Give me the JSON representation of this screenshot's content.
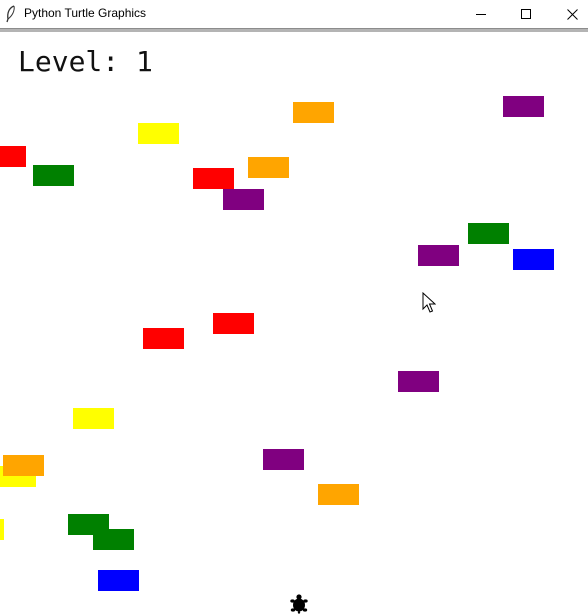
{
  "window": {
    "title": "Python Turtle Graphics",
    "icons": {
      "app": "feather-icon",
      "minimize": "minimize-icon",
      "maximize": "maximize-icon",
      "close": "close-icon"
    }
  },
  "game": {
    "level_label": "Level: 1",
    "colors": {
      "red": "#ff0000",
      "orange": "#ffa500",
      "yellow": "#ffff00",
      "green": "#008000",
      "purple": "#800080",
      "blue": "#0000ff"
    },
    "bricks": [
      {
        "color": "orange"
      },
      {
        "color": "purple"
      },
      {
        "color": "yellow"
      },
      {
        "color": "red"
      },
      {
        "color": "green"
      },
      {
        "color": "orange"
      },
      {
        "color": "red"
      },
      {
        "color": "purple"
      },
      {
        "color": "green"
      },
      {
        "color": "purple"
      },
      {
        "color": "blue"
      },
      {
        "color": "red"
      },
      {
        "color": "red"
      },
      {
        "color": "purple"
      },
      {
        "color": "yellow"
      },
      {
        "color": "purple"
      },
      {
        "color": "yellow"
      },
      {
        "color": "orange"
      },
      {
        "color": "orange"
      },
      {
        "color": "yellow"
      },
      {
        "color": "green"
      },
      {
        "color": "green"
      },
      {
        "color": "blue"
      }
    ],
    "player_icon": "turtle-icon",
    "cursor_icon": "mouse-pointer-icon"
  }
}
